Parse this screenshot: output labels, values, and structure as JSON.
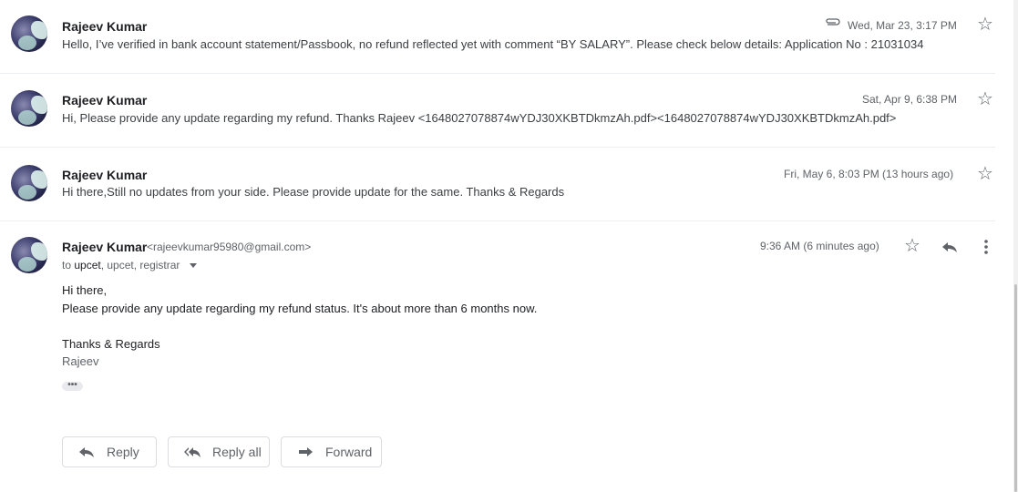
{
  "messages": [
    {
      "sender": "Rajeev Kumar",
      "date": "Wed, Mar 23, 3:17 PM",
      "snippet": "Hello, I’ve verified in bank account statement/Passbook, no refund reflected yet with comment “BY SALARY”. Please check below details: Application No : 21031034",
      "has_attachment_icon": "paperclip-icon"
    },
    {
      "sender": "Rajeev Kumar",
      "date": "Sat, Apr 9, 6:38 PM",
      "snippet": "Hi, Please provide any update regarding my refund. Thanks Rajeev <1648027078874wYDJ30XKBTDkmzAh.pdf><1648027078874wYDJ30XKBTDkmzAh.pdf>"
    },
    {
      "sender": "Rajeev Kumar",
      "date": "Fri, May 6, 8:03 PM (13 hours ago)",
      "snippet": "Hi there,Still no updates from your side. Please provide update for the same. Thanks & Regards"
    }
  ],
  "expanded": {
    "sender": "Rajeev Kumar",
    "email": "<rajeevkumar95980@gmail.com>",
    "date": "9:36 AM (6 minutes ago)",
    "to_prefix": "to ",
    "to_first": "upcet",
    "to_rest": ", upcet, registrar",
    "body": {
      "greeting": "Hi there,",
      "line1": "Please provide any update regarding my refund status. It's about more than 6 months now.",
      "closing": "Thanks & Regards",
      "signature": "Rajeev"
    },
    "trimmed_content": "•••"
  },
  "actions": {
    "reply": "Reply",
    "reply_all": "Reply all",
    "forward": "Forward"
  },
  "icons": {
    "star": "star-icon",
    "reply": "reply-icon",
    "more": "more-vert-icon"
  },
  "colors": {
    "text_primary": "#202124",
    "text_secondary": "#5f6368",
    "divider": "#eceff1"
  }
}
